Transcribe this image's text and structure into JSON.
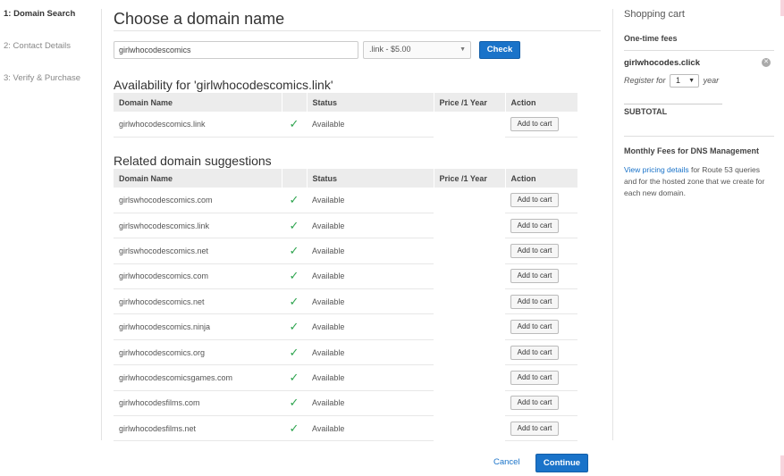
{
  "steps": [
    {
      "label": "1: Domain Search",
      "active": true
    },
    {
      "label": "2: Contact Details",
      "active": false
    },
    {
      "label": "3: Verify & Purchase",
      "active": false
    }
  ],
  "page_title": "Choose a domain name",
  "search": {
    "value": "girlwhocodescomics",
    "tld_selected": ".link - $5.00",
    "check_label": "Check"
  },
  "availability": {
    "title": "Availability for 'girlwhocodescomics.link'",
    "columns": [
      "Domain Name",
      "",
      "Status",
      "Price /1 Year",
      "Action"
    ],
    "rows": [
      {
        "domain": "girlwhocodescomics.link",
        "status": "Available",
        "price": "",
        "action": "Add to cart"
      }
    ]
  },
  "suggestions": {
    "title": "Related domain suggestions",
    "columns": [
      "Domain Name",
      "",
      "Status",
      "Price /1 Year",
      "Action"
    ],
    "rows": [
      {
        "domain": "girlswhocodescomics.com",
        "status": "Available",
        "action": "Add to cart"
      },
      {
        "domain": "girlswhocodescomics.link",
        "status": "Available",
        "action": "Add to cart"
      },
      {
        "domain": "girlswhocodescomics.net",
        "status": "Available",
        "action": "Add to cart"
      },
      {
        "domain": "girlwhocodescomics.com",
        "status": "Available",
        "action": "Add to cart"
      },
      {
        "domain": "girlwhocodescomics.net",
        "status": "Available",
        "action": "Add to cart"
      },
      {
        "domain": "girlwhocodescomics.ninja",
        "status": "Available",
        "action": "Add to cart"
      },
      {
        "domain": "girlwhocodescomics.org",
        "status": "Available",
        "action": "Add to cart"
      },
      {
        "domain": "girlwhocodescomicsgames.com",
        "status": "Available",
        "action": "Add to cart"
      },
      {
        "domain": "girlwhocodesfilms.com",
        "status": "Available",
        "action": "Add to cart"
      },
      {
        "domain": "girlwhocodesfilms.net",
        "status": "Available",
        "action": "Add to cart"
      }
    ]
  },
  "footer": {
    "cancel_label": "Cancel",
    "continue_label": "Continue"
  },
  "cart": {
    "title": "Shopping cart",
    "one_time_fees": "One-time fees",
    "item_domain": "girlwhocodes.click",
    "register_for": "Register for",
    "years": "1",
    "year_word": "year",
    "subtotal": "SUBTOTAL",
    "monthly_title": "Monthly Fees for DNS Management",
    "pricing_link": "View pricing details",
    "monthly_text": " for Route 53 queries and for the hosted zone that we create for each new domain."
  },
  "icons": {
    "check": "checkmark-icon",
    "remove": "remove-icon",
    "dropdown": "chevron-down-icon"
  },
  "colors": {
    "primary": "#1a73c9",
    "available_check": "#2ea44f",
    "header_bg": "#ececec"
  }
}
